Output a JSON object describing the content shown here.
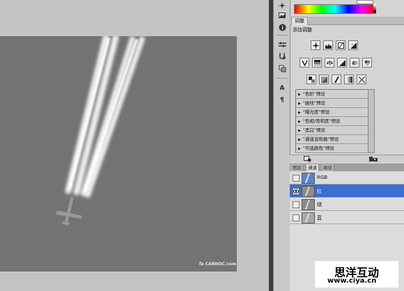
{
  "photo": {
    "watermark": "fe CARNOC.com"
  },
  "tools": {
    "icons": [
      "sparkle-icon",
      "image-icon",
      "info-icon",
      "brush-settings-icon",
      "clone-source-icon",
      "layers-comp-icon",
      "text-A-icon",
      "paragraph-icon"
    ],
    "text_a": "A",
    "paragraph": "¶",
    "info": "i"
  },
  "color": {
    "spectrum": "#ff0000"
  },
  "adjustments": {
    "tab_label": "调整",
    "title": "添加调整",
    "presets": [
      "\"色阶\"预设",
      "\"曲线\"预设",
      "\"曝光度\"预设",
      "\"色相/饱和度\"预设",
      "\"黑白\"预设",
      "\"通道混和器\"预设",
      "\"可选颜色\"预设"
    ]
  },
  "channels": {
    "tabs": [
      "图层",
      "通道",
      "路径"
    ],
    "active_tab": "通道",
    "rows": [
      {
        "name": "RGB",
        "visible": false,
        "selected": false
      },
      {
        "name": "红",
        "visible": true,
        "selected": true
      },
      {
        "name": "绿",
        "visible": false,
        "selected": false
      },
      {
        "name": "蓝",
        "visible": false,
        "selected": false
      }
    ],
    "selection_color": "#3a6fd0"
  },
  "logo": {
    "name": "思洋互动",
    "url": "www.ciya.cn"
  }
}
